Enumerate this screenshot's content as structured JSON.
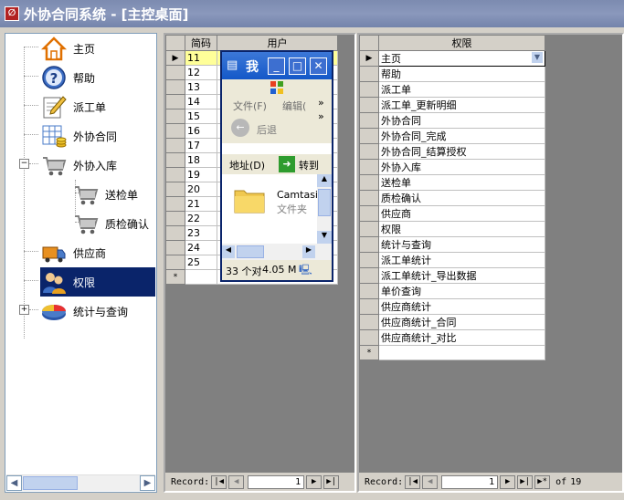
{
  "window": {
    "title": "外协合同系统 - [主控桌面]"
  },
  "tree": {
    "items": [
      {
        "label": "主页"
      },
      {
        "label": "帮助"
      },
      {
        "label": "派工单"
      },
      {
        "label": "外协合同"
      },
      {
        "label": "外协入库"
      },
      {
        "label": "送检单"
      },
      {
        "label": "质检确认"
      },
      {
        "label": "供应商"
      },
      {
        "label": "权限"
      },
      {
        "label": "统计与查询"
      }
    ],
    "expander_open": "−",
    "expander_closed": "+"
  },
  "left_grid": {
    "columns": [
      "简码",
      "用户"
    ],
    "rows": [
      "11",
      "12",
      "13",
      "14",
      "15",
      "16",
      "17",
      "18",
      "19",
      "20",
      "21",
      "22",
      "23",
      "24",
      "25"
    ],
    "new_row_marker": "*",
    "current_row_marker": "▶",
    "nav": {
      "label": "Record:",
      "current": "1"
    }
  },
  "right_grid": {
    "columns": [
      "权限"
    ],
    "rows": [
      "主页",
      "帮助",
      "派工单",
      "派工单_更新明细",
      "外协合同",
      "外协合同_完成",
      "外协合同_结算授权",
      "外协入库",
      "送检单",
      "质检确认",
      "供应商",
      "权限",
      "统计与查询",
      "派工单统计",
      "派工单统计_导出数据",
      "单价查询",
      "供应商统计",
      "供应商统计_合同",
      "供应商统计_对比"
    ],
    "new_row_marker": "*",
    "current_row_marker": "▶",
    "nav": {
      "label": "Record:",
      "current": "1",
      "of": "of",
      "total": "19"
    }
  },
  "explorer": {
    "title": "我",
    "menu_file": "文件(F)",
    "menu_edit": "编辑(",
    "back_label": "后退",
    "address_label": "地址(D)",
    "go_label": "转到",
    "folder_name": "Camtasia",
    "folder_type": "文件夹",
    "status_count": "33 个对",
    "status_size": "4.05 M"
  }
}
